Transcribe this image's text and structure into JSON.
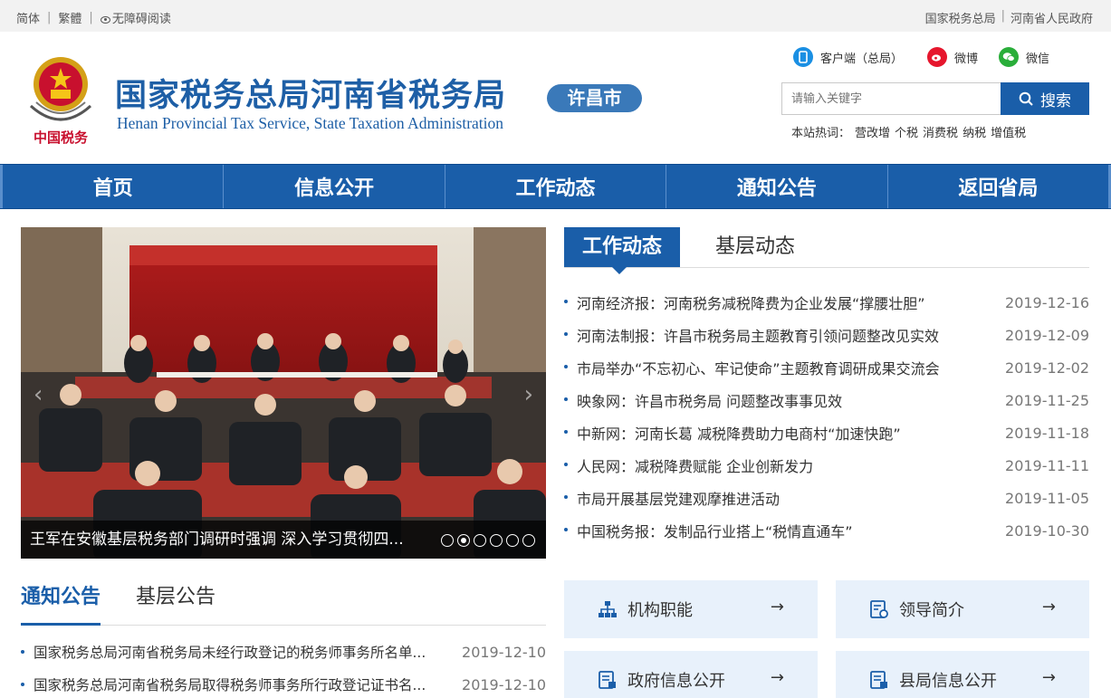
{
  "topbar": {
    "simplified": "简体",
    "traditional": "繁體",
    "accessible": "无障碍阅读",
    "link_sat": "国家税务总局",
    "link_gov": "河南省人民政府",
    "sep": "|"
  },
  "header": {
    "title_cn": "国家税务总局河南省税务局",
    "title_en": "Henan Provincial Tax Service, State Taxation Administration",
    "city": "许昌市",
    "emblem_text": "中国税务",
    "client": "客户端（总局）",
    "weibo": "微博",
    "wechat": "微信",
    "search_placeholder": "请输入关键字",
    "search_button": "搜索",
    "hot_label": "本站热词：",
    "hot_words": [
      "营改增",
      "个税",
      "消费税",
      "纳税",
      "增值税"
    ]
  },
  "nav": {
    "items": [
      "首页",
      "信息公开",
      "工作动态",
      "通知公告",
      "返回省局"
    ]
  },
  "carousel": {
    "caption": "王军在安徽基层税务部门调研时强调 深入学习贯彻四...",
    "slide_count": 6,
    "active_index": 1
  },
  "news": {
    "tab_active": "工作动态",
    "tab_other": "基层动态",
    "items": [
      {
        "title": "河南经济报：河南税务减税降费为企业发展“撑腰壮胆”",
        "date": "2019-12-16"
      },
      {
        "title": "河南法制报：许昌市税务局主题教育引领问题整改见实效",
        "date": "2019-12-09"
      },
      {
        "title": "市局举办“不忘初心、牢记使命”主题教育调研成果交流会",
        "date": "2019-12-02"
      },
      {
        "title": "映象网：许昌市税务局 问题整改事事见效",
        "date": "2019-11-25"
      },
      {
        "title": "中新网：河南长葛 减税降费助力电商村“加速快跑”",
        "date": "2019-11-18"
      },
      {
        "title": "人民网：减税降费赋能 企业创新发力",
        "date": "2019-11-11"
      },
      {
        "title": "市局开展基层党建观摩推进活动",
        "date": "2019-11-05"
      },
      {
        "title": "中国税务报：发制品行业搭上“税情直通车”",
        "date": "2019-10-30"
      }
    ]
  },
  "notice": {
    "tab_active": "通知公告",
    "tab_other": "基层公告",
    "items": [
      {
        "title": "国家税务总局河南省税务局未经行政登记的税务师事务所名单...",
        "date": "2019-12-10"
      },
      {
        "title": "国家税务总局河南省税务局取得税务师事务所行政登记证书名...",
        "date": "2019-12-10"
      }
    ]
  },
  "cards": {
    "org": "机构职能",
    "leaders": "领导简介",
    "gov_info": "政府信息公开",
    "county_info": "县局信息公开",
    "arrow": "→"
  },
  "colors": {
    "brand_blue": "#1a5ea9",
    "badge_blue": "#3a79b9",
    "card_bg": "#e8f1fb"
  }
}
